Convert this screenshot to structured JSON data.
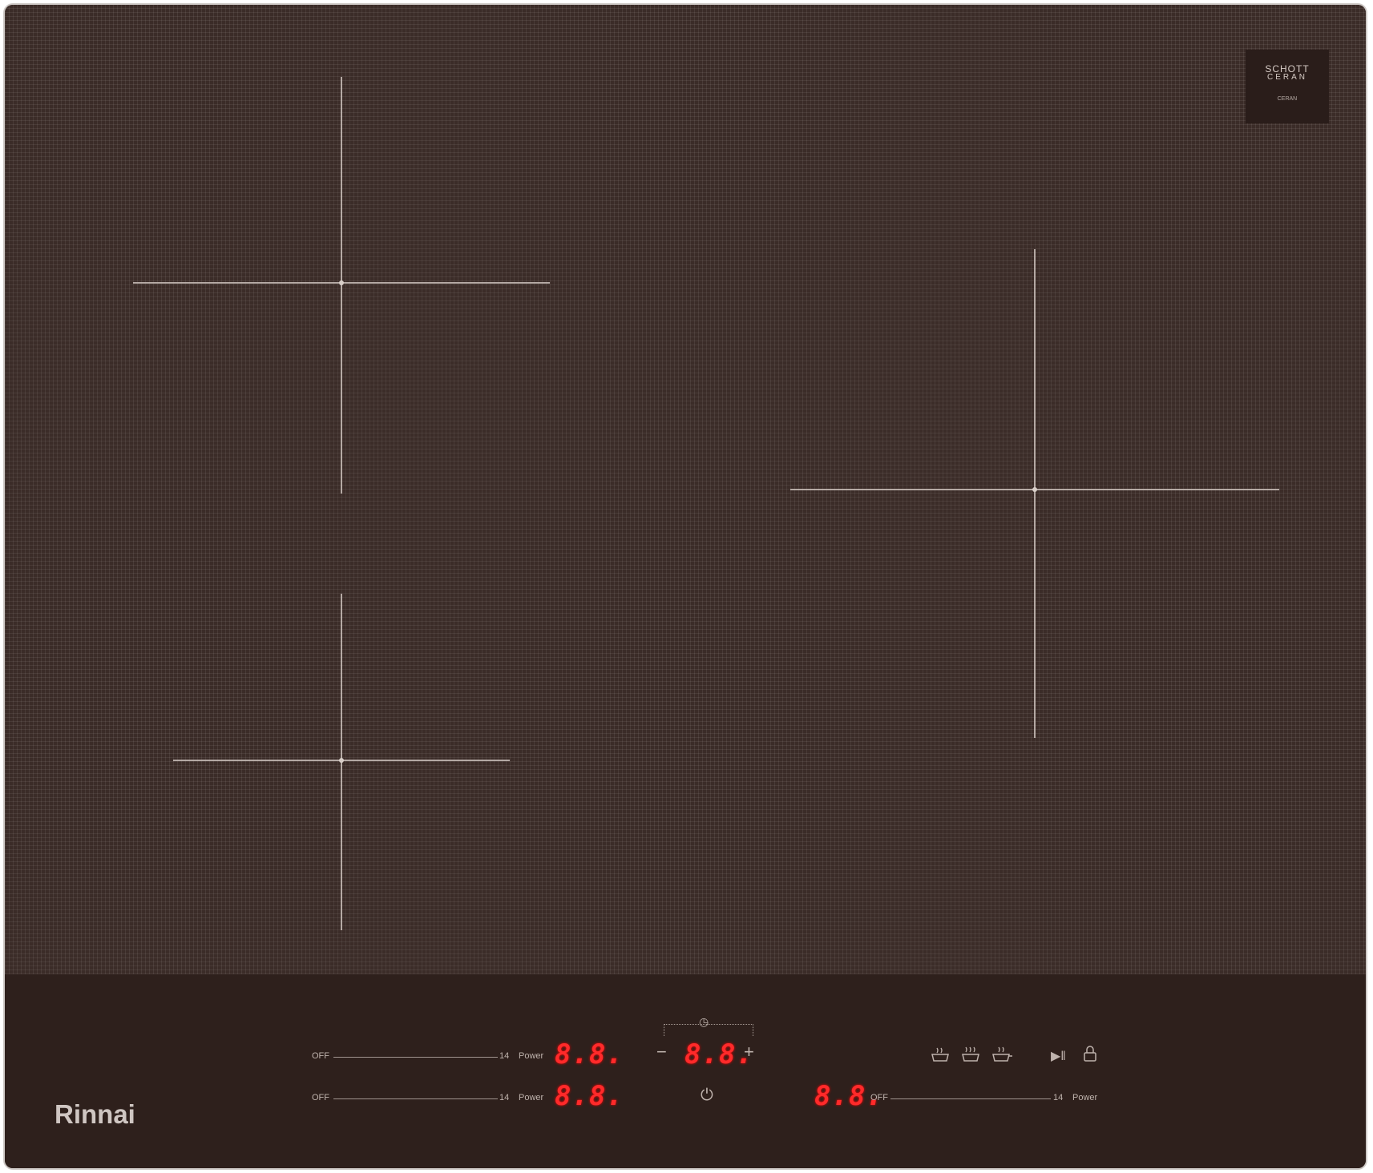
{
  "brand": {
    "logo_text": "Rinnai"
  },
  "badge": {
    "line1": "SCHOTT",
    "line2": "CERAN",
    "line3": "CERAN"
  },
  "zones": [
    {
      "name": "front-left"
    },
    {
      "name": "rear-left"
    },
    {
      "name": "right"
    }
  ],
  "controls": {
    "slider_rear_left": {
      "off_label": "OFF",
      "max_label": "14",
      "power_label": "Power"
    },
    "slider_front_left": {
      "off_label": "OFF",
      "max_label": "14",
      "power_label": "Power"
    },
    "slider_right": {
      "off_label": "OFF",
      "max_label": "14",
      "power_label": "Power"
    },
    "display_rear_left": "8.8.",
    "display_front_left": "8.8.",
    "display_timer": "8.8.",
    "display_right": "8.8.",
    "minus_glyph": "−",
    "plus_glyph": "+",
    "timer_glyph": "◷",
    "power_glyph": "⏻",
    "pause_glyph": "▶‖",
    "lock_glyph": "🔒",
    "preset_icons": [
      "keep-warm-icon",
      "simmer-icon",
      "boil-icon"
    ]
  },
  "colors": {
    "glass": "#3b2c28",
    "display_red": "#ff2a2a"
  }
}
